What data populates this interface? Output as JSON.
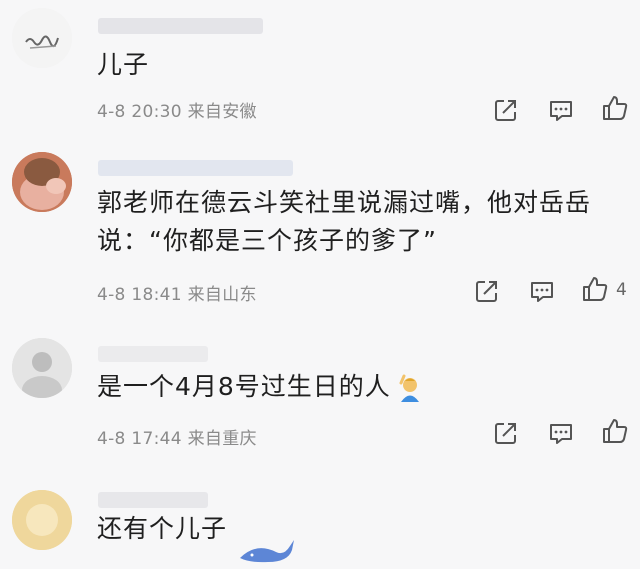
{
  "comments": [
    {
      "username": "",
      "text": "儿子",
      "date": "4-8",
      "time": "20:30",
      "location": "来自安徽",
      "likes": ""
    },
    {
      "username": "",
      "text": "郭老师在德云斗笑社里说漏过嘴，他对岳岳说：“你都是三个孩子的爹了”",
      "date": "4-8",
      "time": "18:41",
      "location": "来自山东",
      "likes": "4"
    },
    {
      "username": "",
      "text": "是一个4月8号过生日的人",
      "emoji": "person-gesturing-emoji",
      "date": "4-8",
      "time": "17:44",
      "location": "来自重庆",
      "likes": ""
    },
    {
      "username": "",
      "text": "还有个儿子",
      "emoji": "whale-sticker"
    }
  ],
  "icons": {
    "share": "share-icon",
    "reply": "reply-icon",
    "like": "like-icon"
  },
  "colors": {
    "background": "#f7f7f8",
    "meta_text": "#8a8a8a",
    "icon_stroke": "#555555"
  }
}
